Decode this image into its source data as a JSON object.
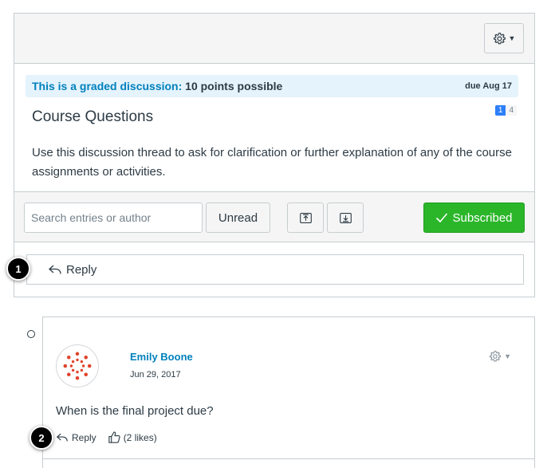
{
  "topic": {
    "graded_label": "This is a graded discussion:",
    "points": "10 points possible",
    "due": "due Aug 17",
    "unread_count": "1",
    "total_count": "4",
    "title": "Course Questions",
    "message": "Use this discussion thread to ask for clarification or further explanation of any of the course assignments or activities."
  },
  "toolbar": {
    "search_placeholder": "Search entries or author",
    "unread_label": "Unread",
    "subscribed_label": "Subscribed"
  },
  "reply": {
    "label": "Reply"
  },
  "callouts": [
    "1",
    "2"
  ],
  "entry": {
    "author": "Emily Boone",
    "date": "Jun 29, 2017",
    "message": "When is the final project due?",
    "reply_label": "Reply",
    "likes": "(2 likes)"
  },
  "colors": {
    "link": "#0081bd",
    "subscribed_bg": "#2bb62a",
    "graded_bg": "#e5f3fc",
    "unread_badge": "#2d7ff9",
    "avatar_red": "#e0442b"
  },
  "icons": [
    "gear-icon",
    "caret-down-icon",
    "checkmark-icon",
    "expand-icon",
    "collapse-icon",
    "reply-arrow-icon",
    "thumbs-up-icon",
    "canvas-logo-avatar"
  ]
}
